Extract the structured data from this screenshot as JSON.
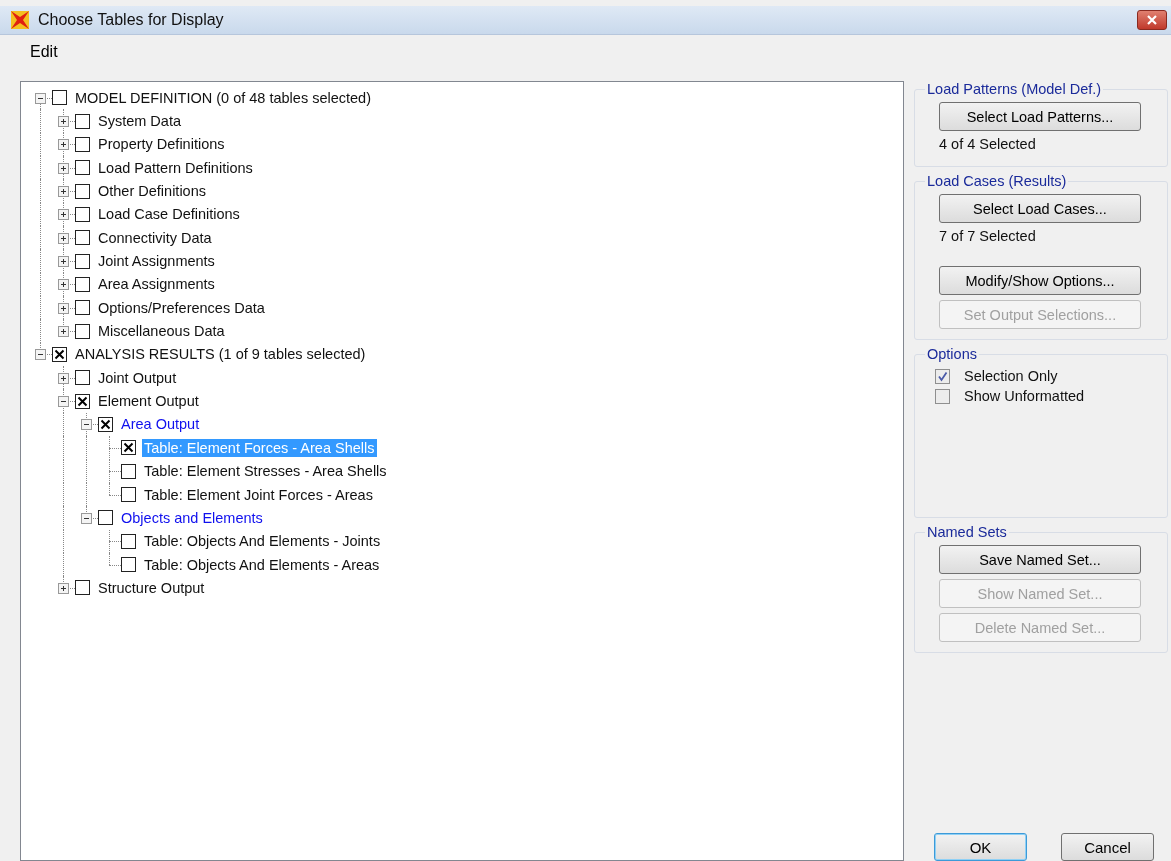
{
  "window": {
    "title": "Choose Tables for Display"
  },
  "menu": [
    {
      "label": "Edit"
    }
  ],
  "tree": [
    {
      "label": "MODEL DEFINITION  (0 of 48 tables selected)",
      "kind": "plain",
      "checked": false,
      "selected": false,
      "expanded": true,
      "children": [
        {
          "label": "System Data",
          "kind": "plain",
          "checked": false,
          "selected": false,
          "expanded": false
        },
        {
          "label": "Property Definitions",
          "kind": "plain",
          "checked": false,
          "selected": false,
          "expanded": false
        },
        {
          "label": "Load Pattern Definitions",
          "kind": "plain",
          "checked": false,
          "selected": false,
          "expanded": false
        },
        {
          "label": "Other Definitions",
          "kind": "plain",
          "checked": false,
          "selected": false,
          "expanded": false
        },
        {
          "label": "Load Case Definitions",
          "kind": "plain",
          "checked": false,
          "selected": false,
          "expanded": false
        },
        {
          "label": "Connectivity Data",
          "kind": "plain",
          "checked": false,
          "selected": false,
          "expanded": false
        },
        {
          "label": "Joint Assignments",
          "kind": "plain",
          "checked": false,
          "selected": false,
          "expanded": false
        },
        {
          "label": "Area Assignments",
          "kind": "plain",
          "checked": false,
          "selected": false,
          "expanded": false
        },
        {
          "label": "Options/Preferences Data",
          "kind": "plain",
          "checked": false,
          "selected": false,
          "expanded": false
        },
        {
          "label": "Miscellaneous Data",
          "kind": "plain",
          "checked": false,
          "selected": false,
          "expanded": false
        }
      ]
    },
    {
      "label": "ANALYSIS RESULTS  (1 of 9 tables selected)",
      "kind": "plain",
      "checked": true,
      "selected": false,
      "expanded": true,
      "children": [
        {
          "label": "Joint Output",
          "kind": "plain",
          "checked": false,
          "selected": false,
          "expanded": false
        },
        {
          "label": "Element Output",
          "kind": "plain",
          "checked": true,
          "selected": false,
          "expanded": true,
          "children": [
            {
              "label": "Area Output",
              "kind": "group",
              "checked": true,
              "selected": false,
              "expanded": true,
              "children": [
                {
                  "label": "Table:  Element Forces - Area Shells",
                  "kind": "table",
                  "checked": true,
                  "selected": true
                },
                {
                  "label": "Table:  Element Stresses - Area Shells",
                  "kind": "table",
                  "checked": false,
                  "selected": false
                },
                {
                  "label": "Table:  Element Joint Forces - Areas",
                  "kind": "table",
                  "checked": false,
                  "selected": false
                }
              ]
            },
            {
              "label": "Objects and Elements",
              "kind": "group",
              "checked": false,
              "selected": false,
              "expanded": true,
              "children": [
                {
                  "label": "Table:  Objects And Elements - Joints",
                  "kind": "table",
                  "checked": false,
                  "selected": false
                },
                {
                  "label": "Table:  Objects And Elements - Areas",
                  "kind": "table",
                  "checked": false,
                  "selected": false
                }
              ]
            }
          ]
        },
        {
          "label": "Structure Output",
          "kind": "plain",
          "checked": false,
          "selected": false,
          "expanded": false
        }
      ]
    }
  ],
  "groups": [
    {
      "title": "Load Patterns (Model Def.)",
      "items": [
        {
          "kind": "button",
          "label": "Select Load Patterns...",
          "disabled": false
        },
        {
          "kind": "text",
          "label": "4 of 4 Selected"
        }
      ]
    },
    {
      "title": "Load Cases (Results)",
      "items": [
        {
          "kind": "button",
          "label": "Select Load Cases...",
          "disabled": false
        },
        {
          "kind": "text",
          "label": "7 of 7 Selected"
        },
        {
          "kind": "button",
          "label": "Modify/Show Options...",
          "disabled": false
        },
        {
          "kind": "button",
          "label": "Set Output Selections...",
          "disabled": true
        }
      ]
    },
    {
      "title": "Options",
      "items": [
        {
          "kind": "checkbox",
          "label": "Selection Only",
          "checked": true
        },
        {
          "kind": "checkbox",
          "label": "Show Unformatted",
          "checked": false
        }
      ]
    },
    {
      "title": "Named Sets",
      "items": [
        {
          "kind": "button",
          "label": "Save Named Set...",
          "disabled": false
        },
        {
          "kind": "button",
          "label": "Show Named Set...",
          "disabled": true
        },
        {
          "kind": "button",
          "label": "Delete Named Set...",
          "disabled": true
        }
      ]
    }
  ],
  "buttons": [
    {
      "label": "OK",
      "default": true
    },
    {
      "label": "Cancel",
      "default": false
    }
  ]
}
